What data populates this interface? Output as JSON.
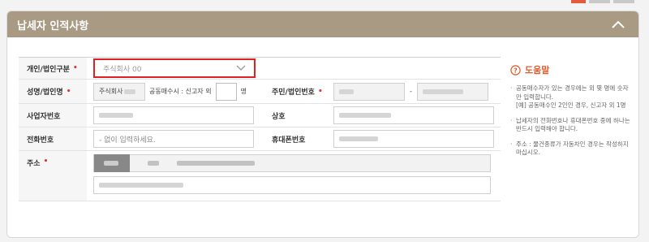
{
  "header": {
    "title": "납세자 인적사항"
  },
  "form": {
    "entity_type": {
      "label": "개인/법인구분",
      "value": "주식회사 00"
    },
    "name": {
      "label": "성명/법인명",
      "value_prefix": "주식회사",
      "co_owner_text": "공동매수시 : 신고자 외",
      "unit": "명"
    },
    "resident_no": {
      "label": "주민/법인번호"
    },
    "biz_no": {
      "label": "사업자번호"
    },
    "trade_name": {
      "label": "상호"
    },
    "phone": {
      "label": "전화번호",
      "placeholder": "- 없이 입력하세요."
    },
    "mobile": {
      "label": "휴대폰번호"
    },
    "address": {
      "label": "주소"
    }
  },
  "help": {
    "title": "도움말",
    "items": [
      {
        "text": "공동매수자가 있는 경우에는 외 몇 명에 숫자만 입력합니다.",
        "sub": "[예] 공동매수인 2인인 경우, 신고자 외 1명"
      },
      {
        "text": "납세자의 전화번호나 휴대폰번호 중에 하나는 반드시 입력해야 합니다."
      },
      {
        "text": "주소 : 물건종류가 자동차인 경우는 작성하지 마십시오."
      }
    ]
  }
}
